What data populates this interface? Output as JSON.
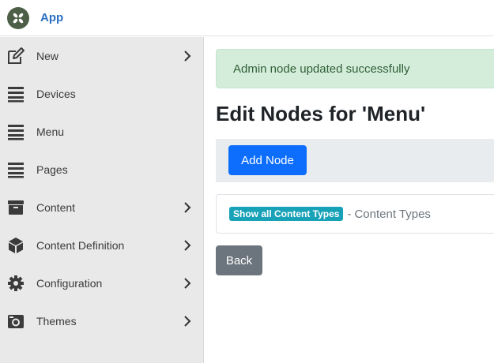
{
  "app": {
    "brand": "App"
  },
  "sidebar": {
    "items": [
      {
        "label": "New",
        "icon": "edit-icon",
        "has_submenu": true
      },
      {
        "label": "Devices",
        "icon": "list-icon",
        "has_submenu": false
      },
      {
        "label": "Menu",
        "icon": "list-icon",
        "has_submenu": false
      },
      {
        "label": "Pages",
        "icon": "list-icon",
        "has_submenu": false
      },
      {
        "label": "Content",
        "icon": "archive-icon",
        "has_submenu": true
      },
      {
        "label": "Content Definition",
        "icon": "cube-icon",
        "has_submenu": true
      },
      {
        "label": "Configuration",
        "icon": "gear-icon",
        "has_submenu": true
      },
      {
        "label": "Themes",
        "icon": "camera-icon",
        "has_submenu": true
      }
    ]
  },
  "main": {
    "alert": "Admin node updated successfully",
    "title": "Edit Nodes for 'Menu'",
    "add_node_label": "Add Node",
    "content_types": {
      "badge": "Show all Content Types",
      "separator": "-",
      "label": "Content Types"
    },
    "back_label": "Back"
  },
  "colors": {
    "primary": "#0d6efd",
    "secondary": "#6c757d",
    "success_bg": "#d4edda",
    "info_badge": "#17a2b8",
    "brand_text": "#2a6fc1"
  }
}
